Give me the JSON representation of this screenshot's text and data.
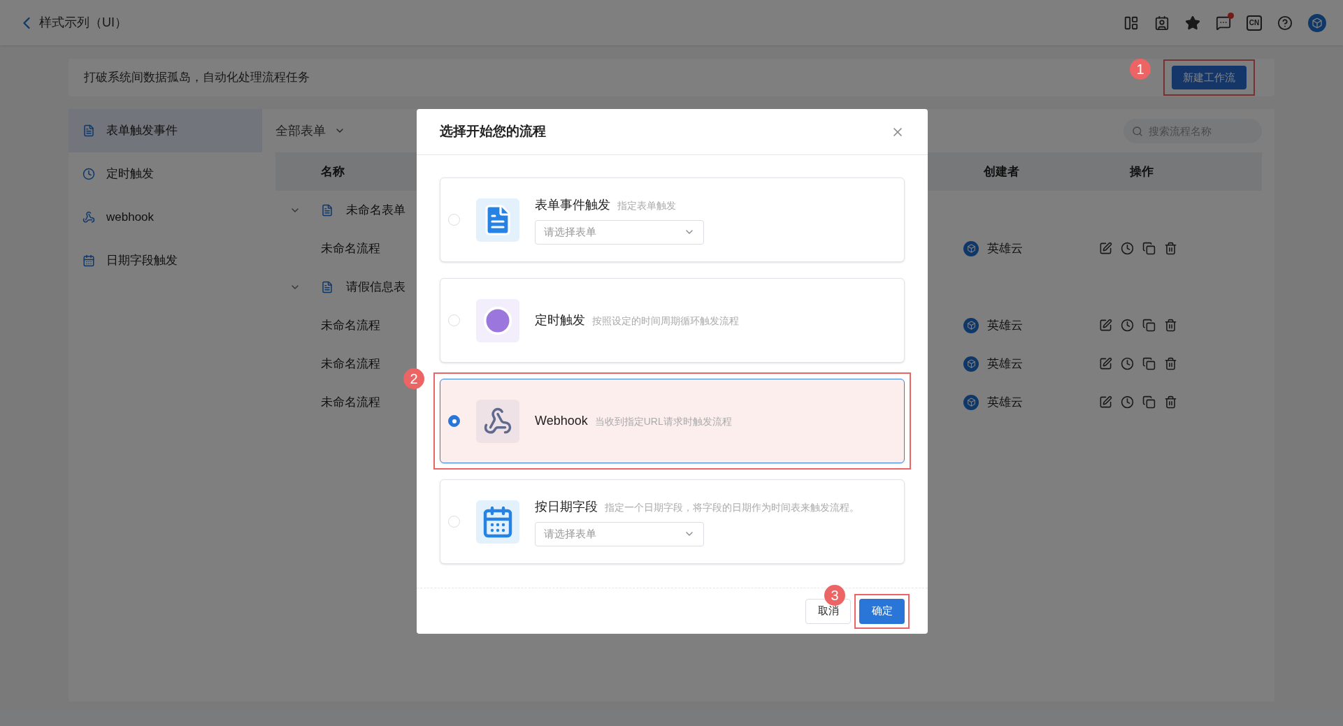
{
  "header": {
    "back_title": "样式示列（UI）",
    "lang_badge": "CN",
    "message_unread": true
  },
  "banner": {
    "text": "打破系统间数据孤岛，自动化处理流程任务",
    "button": "新建工作流",
    "callout": "1"
  },
  "sidebar": {
    "items": [
      {
        "kind": "form",
        "label": "表单触发事件",
        "selected": true
      },
      {
        "kind": "timer",
        "label": "定时触发",
        "selected": false
      },
      {
        "kind": "webhook",
        "label": "webhook",
        "selected": false
      },
      {
        "kind": "date",
        "label": "日期字段触发",
        "selected": false
      }
    ]
  },
  "filter": {
    "label": "全部表单"
  },
  "search": {
    "placeholder": "搜索流程名称"
  },
  "table": {
    "columns": [
      "名称",
      "创建者",
      "操作"
    ],
    "groups": [
      {
        "name": "未命名表单",
        "expanded": true,
        "rows": [
          {
            "name": "未命名流程",
            "creator": "英雄云"
          }
        ]
      },
      {
        "name": "请假信息表",
        "expanded": true,
        "rows": [
          {
            "name": "未命名流程",
            "creator": "英雄云"
          },
          {
            "name": "未命名流程",
            "creator": "英雄云"
          },
          {
            "name": "未命名流程",
            "creator": "英雄云"
          }
        ]
      }
    ]
  },
  "dialog": {
    "title": "选择开始您的流程",
    "options": [
      {
        "kind": "form",
        "title": "表单事件触发",
        "description": "指定表单触发",
        "select_placeholder": "请选择表单",
        "selected": false
      },
      {
        "kind": "timer",
        "title": "定时触发",
        "description": "按照设定的时间周期循环触发流程",
        "selected": false
      },
      {
        "kind": "webhook",
        "title": "Webhook",
        "description": "当收到指定URL请求时触发流程",
        "selected": true,
        "callout": "2"
      },
      {
        "kind": "date",
        "title": "按日期字段",
        "description": "指定一个日期字段，将字段的日期作为时间表来触发流程。",
        "select_placeholder": "请选择表单",
        "selected": false
      }
    ],
    "cancel": "取消",
    "ok": "确定",
    "ok_callout": "3"
  }
}
